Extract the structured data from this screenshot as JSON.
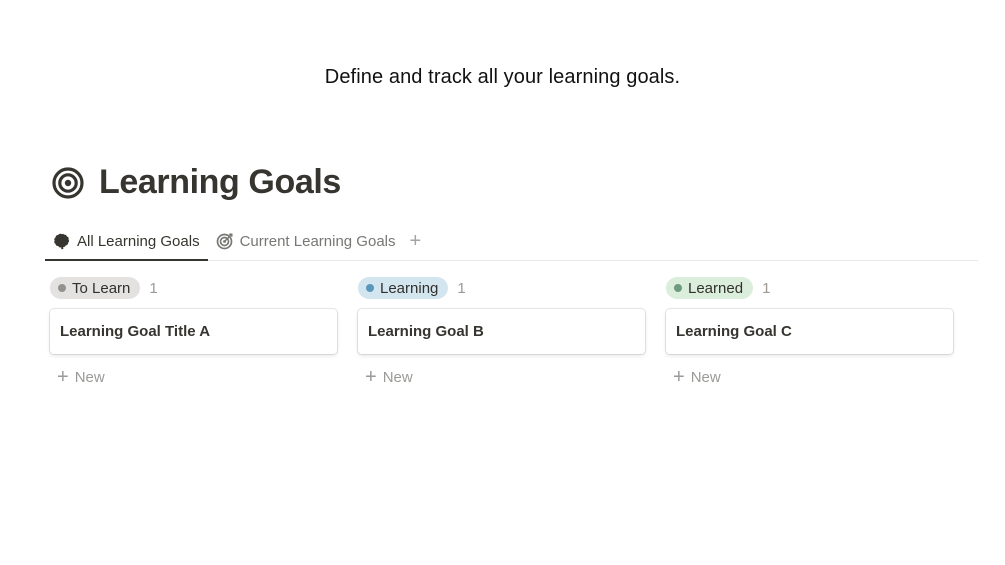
{
  "tagline": "Define and track all your learning goals.",
  "page": {
    "title": "Learning Goals",
    "icon": "target-icon"
  },
  "tabs": [
    {
      "label": "All Learning Goals",
      "icon": "brain-icon",
      "active": true
    },
    {
      "label": "Current Learning Goals",
      "icon": "target-icon",
      "active": false
    }
  ],
  "add_tab_label": "+",
  "columns": [
    {
      "status": "To Learn",
      "count": "1",
      "pill_color": "#e3e2e0",
      "dot_color": "#91918e",
      "cards": [
        "Learning Goal Title A"
      ],
      "new_label": "New"
    },
    {
      "status": "Learning",
      "count": "1",
      "pill_color": "#d3e5ef",
      "dot_color": "#5b97bd",
      "cards": [
        "Learning Goal B"
      ],
      "new_label": "New"
    },
    {
      "status": "Learned",
      "count": "1",
      "pill_color": "#dbeddb",
      "dot_color": "#6c9b7d",
      "cards": [
        "Learning Goal C"
      ],
      "new_label": "New"
    }
  ],
  "colors": {
    "text": "#37352f",
    "muted": "#9b9a97",
    "divider": "#e9e9e7"
  }
}
